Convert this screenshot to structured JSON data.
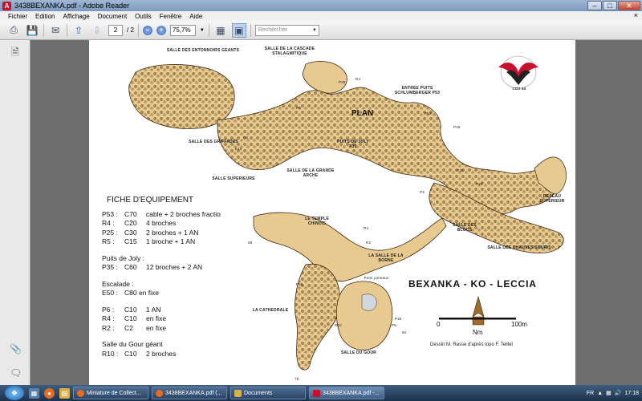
{
  "window": {
    "title": "3438BEXANKA.pdf - Adobe Reader",
    "minimize": "–",
    "maximize": "□",
    "close": "✕"
  },
  "menu": {
    "items": [
      "Fichier",
      "Edition",
      "Affichage",
      "Document",
      "Outils",
      "Fenêtre",
      "Aide"
    ],
    "close_glyph": "×"
  },
  "toolbar": {
    "page_current": "2",
    "page_total": "/ 2",
    "zoom_value": "75,7%",
    "search_placeholder": "Rechercher"
  },
  "map": {
    "plan_label": "PLAN",
    "labels": {
      "entonnoirs": "SALLE DES ENTONNOIRS GEANTS",
      "cascade": "SALLE DE LA CASCADE STALAGMITIQUE",
      "entree": "ENTREE PUITS SCHLUMBERGER P53",
      "griffades": "SALLE DES GRIFFADES",
      "superieure": "SALLE SUPERIEURE",
      "grande_arche": "SALLE DE LA GRANDE ARCHE",
      "puits_joly": "PUITS DE JOLY P35",
      "reseau": "RESEAU SUPERIEUR",
      "temple": "LE TEMPLE CHINOIS",
      "blocs": "SALLE DES BLOCS",
      "chauves": "SALLE DES CHAUVES SOURIS",
      "borne": "LA SALLE DE LA BORNE",
      "cathedrale": "LA CATHEDRALE",
      "gour": "SALLE DU GOUR",
      "puits_jumeaux": "Puits jumeaux"
    },
    "markers": {
      "p25": "P25",
      "r4a": "R4",
      "p53": "P53",
      "p18": "P18",
      "r5": "R5",
      "r6": "R6",
      "e15": "E15",
      "p30": "P30",
      "p20": "P20",
      "p6": "P6",
      "r4b": "R4",
      "r2": "R2",
      "s8": "58",
      "p55": "P55",
      "r10": "R10",
      "p45": "P45",
      "p5": "P5",
      "n92": "92",
      "n78": "78"
    },
    "logo_text": "CDS 64"
  },
  "fiche": {
    "title": "FICHE D'EQUIPEMENT",
    "rows": [
      {
        "code": "P53 :",
        "corde": "C70",
        "desc": "cable + 2 broches fractio"
      },
      {
        "code": "R4 :",
        "corde": "C20",
        "desc": "4 broches"
      },
      {
        "code": "P25 :",
        "corde": "C30",
        "desc": "2 broches + 1 AN"
      },
      {
        "code": "R5 :",
        "corde": "C15",
        "desc": "1 broche + 1 AN"
      }
    ],
    "joly_title": "Puits de Joly :",
    "joly_row": {
      "code": "P35 :",
      "corde": "C60",
      "desc": "12 broches + 2 AN"
    },
    "escalade_title": "Escalade :",
    "escalade_row": {
      "code": "E50 :",
      "desc": "C80 en fixe"
    },
    "rows2": [
      {
        "code": "P6 :",
        "corde": "C10",
        "desc": "1 AN"
      },
      {
        "code": "R4 :",
        "corde": "C10",
        "desc": "en fixe"
      },
      {
        "code": "R2 :",
        "corde": "C2",
        "desc": "en fixe"
      }
    ],
    "gour_title": "Salle du Gour géant",
    "gour_row": {
      "code": "R10 :",
      "corde": "C10",
      "desc": "2 broches"
    }
  },
  "heading": "BEXANKA - KO - LECCIA",
  "scale": {
    "zero": "0",
    "hundred": "100m",
    "north": "Nm"
  },
  "credit": "Dessin M. Rasse d'après topo F. Teillet",
  "taskbar": {
    "tasks": [
      {
        "label": "Miniature de Collect..."
      },
      {
        "label": "3438BEXANKA.pdf (..."
      },
      {
        "label": "Documents"
      },
      {
        "label": "3438BEXANKA.pdf -..."
      }
    ],
    "lang": "FR",
    "time": "17:18"
  },
  "colors": {
    "cave_fill": "#e8c98f",
    "cave_stroke": "#3a2a14",
    "blocks": "#b08a4c"
  }
}
